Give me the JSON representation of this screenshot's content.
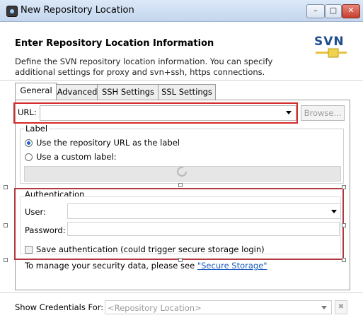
{
  "window": {
    "title": "New Repository Location"
  },
  "header": {
    "title": "Enter Repository Location Information",
    "description": "Define the SVN repository location information. You can specify additional settings for proxy and svn+ssh, https connections.",
    "logo_text": "SVN"
  },
  "tabs": [
    {
      "label": "General",
      "active": true
    },
    {
      "label": "Advanced",
      "active": false
    },
    {
      "label": "SSH Settings",
      "active": false
    },
    {
      "label": "SSL Settings",
      "active": false
    }
  ],
  "url": {
    "label": "URL:",
    "value": "",
    "browse_label": "Browse..."
  },
  "label_group": {
    "title": "Label",
    "option_repo": "Use the repository URL as the label",
    "option_custom": "Use a custom label:",
    "selected": "repo"
  },
  "auth": {
    "title": "Authentication",
    "user_label": "User:",
    "password_label": "Password:",
    "save_label": "Save authentication (could trigger secure storage login)",
    "save_checked": false
  },
  "security": {
    "text": "To manage your security data, please see ",
    "link": "\"Secure Storage\""
  },
  "credentials": {
    "label": "Show Credentials For:",
    "placeholder": "<Repository Location>"
  },
  "colors": {
    "highlight": "#d42a2a",
    "link": "#1a5bbd",
    "title_bg": "#c4d6ee"
  }
}
